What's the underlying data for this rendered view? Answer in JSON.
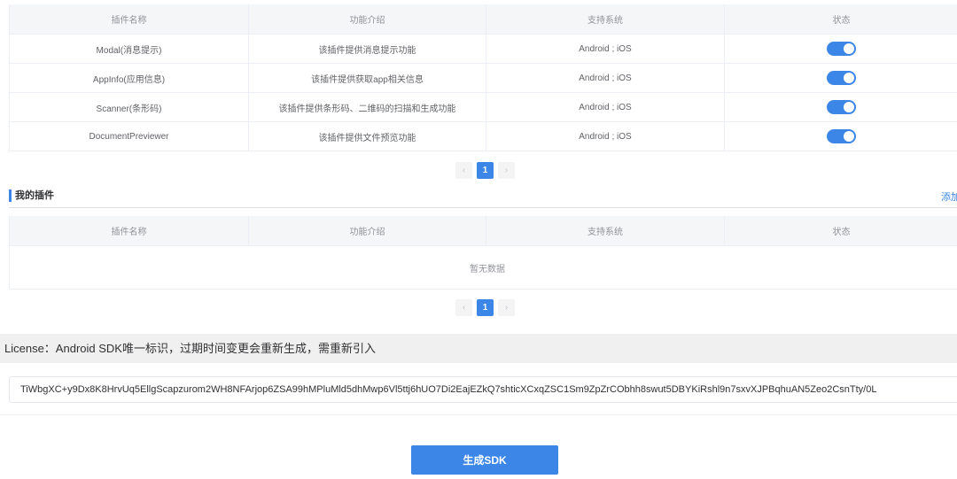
{
  "plugins_table": {
    "headers": [
      "插件名称",
      "功能介绍",
      "支持系统",
      "状态"
    ],
    "rows": [
      {
        "name": "Modal(消息提示)",
        "desc": "该插件提供消息提示功能",
        "system": "Android ; iOS",
        "enabled": true
      },
      {
        "name": "AppInfo(应用信息)",
        "desc": "该插件提供获取app相关信息",
        "system": "Android ; iOS",
        "enabled": true
      },
      {
        "name": "Scanner(条形码)",
        "desc": "该插件提供条形码、二维码的扫描和生成功能",
        "system": "Android ; iOS",
        "enabled": true
      },
      {
        "name": "DocumentPreviewer",
        "desc": "该插件提供文件预览功能",
        "system": "Android ; iOS",
        "enabled": true
      }
    ]
  },
  "pager1": {
    "prev": "‹",
    "page": "1",
    "next": "›"
  },
  "my_plugins": {
    "title": "我的插件",
    "add_label": "添加",
    "headers": [
      "插件名称",
      "功能介绍",
      "支持系统",
      "状态"
    ],
    "empty": "暂无数据"
  },
  "pager2": {
    "prev": "‹",
    "page": "1",
    "next": "›"
  },
  "license": {
    "label": "License：Android SDK唯一标识，过期时间变更会重新生成，需重新引入",
    "value": "TiWbgXC+y9Dx8K8HrvUq5EllgScapzurom2WH8NFArjop6ZSA99hMPluMld5dhMwp6Vl5ttj6hUO7Di2EajEZkQ7shticXCxqZSC1Sm9ZpZrCObhh8swut5DBYKiRshl9n7sxvXJPBqhuAN5Zeo2CsnTty/0L"
  },
  "generate_button": "生成SDK",
  "colors": {
    "accent": "#3b86e6"
  }
}
